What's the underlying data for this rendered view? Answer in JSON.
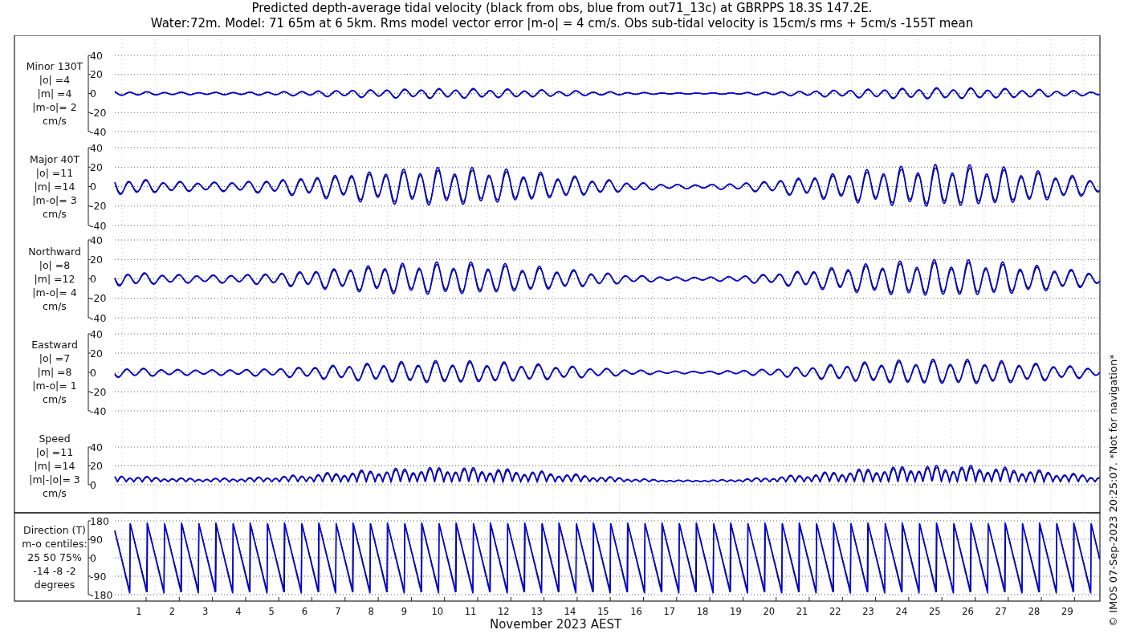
{
  "title_lines": [
    "Predicted depth-average tidal velocity (black from obs, blue from out71_13c) at GBRPPS 18.3S 147.2E.",
    "Water:72m. Model: 71 65m at 6 5km. Rms model vector error |m-o| = 4 cm/s. Obs sub-tidal velocity is 15cm/s rms + 5cm/s -155T mean"
  ],
  "panels": [
    {
      "kind": "velocity",
      "label_lines": [
        "Minor 130T",
        "|o| =4",
        "|m| =4",
        "|m-o|= 2",
        "cm/s"
      ],
      "yticks": [
        "40",
        "20",
        "0",
        "-20",
        "-40"
      ]
    },
    {
      "kind": "velocity",
      "label_lines": [
        "Major 40T",
        "|o| =11",
        "|m| =14",
        "|m-o|= 3",
        "cm/s"
      ],
      "yticks": [
        "40",
        "20",
        "0",
        "-20",
        "-40"
      ]
    },
    {
      "kind": "velocity",
      "label_lines": [
        "Northward",
        "|o| =8",
        "|m| =12",
        "|m-o|= 4",
        "cm/s"
      ],
      "yticks": [
        "40",
        "20",
        "0",
        "-20",
        "-40"
      ]
    },
    {
      "kind": "velocity",
      "label_lines": [
        "Eastward",
        "|o| =7",
        "|m| =8",
        "|m-o|= 1",
        "cm/s"
      ],
      "yticks": [
        "40",
        "20",
        "0",
        "-20",
        "-40"
      ]
    },
    {
      "kind": "speed",
      "label_lines": [
        "Speed",
        "|o| =11",
        "|m| =14",
        "|m|-|o|= 3",
        "cm/s"
      ],
      "yticks": [
        "40",
        "20",
        "0"
      ]
    },
    {
      "kind": "direction",
      "label_lines": [
        "Direction (T)",
        "m-o centiles:",
        "25  50  75%",
        "-14  -8  -2",
        "degrees"
      ],
      "yticks": [
        "180",
        "90",
        "0",
        "-90",
        "-180"
      ]
    }
  ],
  "xticks": [
    "1",
    "2",
    "3",
    "4",
    "5",
    "6",
    "7",
    "8",
    "9",
    "10",
    "11",
    "12",
    "13",
    "14",
    "15",
    "16",
    "17",
    "18",
    "19",
    "20",
    "21",
    "22",
    "23",
    "24",
    "25",
    "26",
    "27",
    "28",
    "29"
  ],
  "xlabel": "November 2023 AEST",
  "credit": "© IMOS 07-Sep-2023 20:25:07. *Not for navigation*"
}
